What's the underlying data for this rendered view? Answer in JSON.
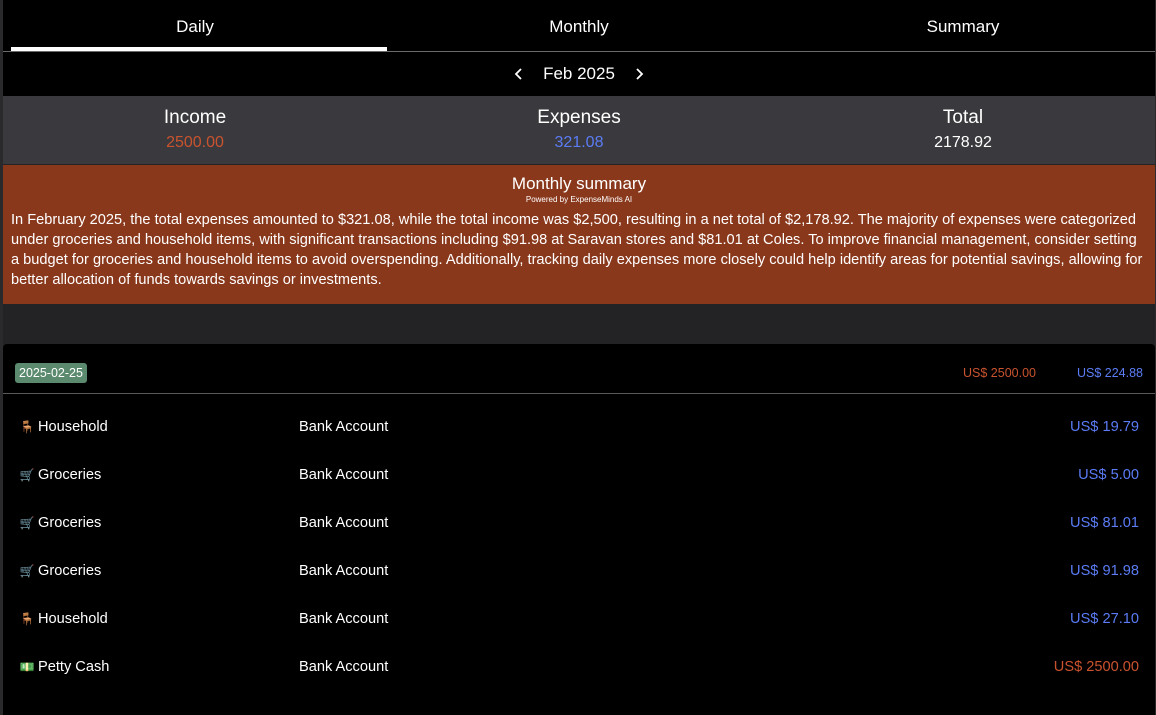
{
  "tabs": [
    {
      "label": "Daily",
      "active": true
    },
    {
      "label": "Monthly",
      "active": false
    },
    {
      "label": "Summary",
      "active": false
    }
  ],
  "month_nav": {
    "current": "Feb 2025",
    "prev_icon": "chevron-left-icon",
    "next_icon": "chevron-right-icon"
  },
  "totals": {
    "income_label": "Income",
    "income_value": "2500.00",
    "expenses_label": "Expenses",
    "expenses_value": "321.08",
    "total_label": "Total",
    "total_value": "2178.92"
  },
  "summary": {
    "title": "Monthly summary",
    "powered_by": "Powered by ExpenseMinds AI",
    "text": "In February 2025, the total expenses amounted to $321.08, while the total income was $2,500, resulting in a net total of $2,178.92. The majority of expenses were categorized under groceries and household items, with significant transactions including $91.98 at Saravan stores and $81.01 at Coles. To improve financial management, consider setting a budget for groceries and household items to avoid overspending. Additionally, tracking daily expenses more closely could help identify areas for potential savings, allowing for better allocation of funds towards savings or investments."
  },
  "day_group": {
    "date": "2025-02-25",
    "income": "US$ 2500.00",
    "expense": "US$ 224.88"
  },
  "transactions": [
    {
      "icon": "🪑",
      "icon_name": "chair-icon",
      "category": "Household",
      "account": "Bank Account",
      "amount": "US$ 19.79",
      "kind": "expense"
    },
    {
      "icon": "🛒",
      "icon_name": "cart-icon",
      "category": "Groceries",
      "account": "Bank Account",
      "amount": "US$ 5.00",
      "kind": "expense"
    },
    {
      "icon": "🛒",
      "icon_name": "cart-icon",
      "category": "Groceries",
      "account": "Bank Account",
      "amount": "US$ 81.01",
      "kind": "expense"
    },
    {
      "icon": "🛒",
      "icon_name": "cart-icon",
      "category": "Groceries",
      "account": "Bank Account",
      "amount": "US$ 91.98",
      "kind": "expense"
    },
    {
      "icon": "🪑",
      "icon_name": "chair-icon",
      "category": "Household",
      "account": "Bank Account",
      "amount": "US$ 27.10",
      "kind": "expense"
    },
    {
      "icon": "💵",
      "icon_name": "cash-icon",
      "category": "Petty Cash",
      "account": "Bank Account",
      "amount": "US$ 2500.00",
      "kind": "income"
    }
  ],
  "colors": {
    "income": "#c9532e",
    "expense": "#5b7cf5",
    "summary_bg": "#8a381c",
    "badge_bg": "#5b8a6e"
  }
}
